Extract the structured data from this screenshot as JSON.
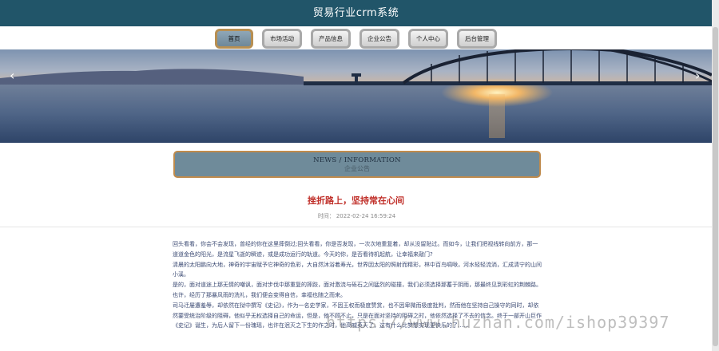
{
  "header": {
    "title": "贸易行业crm系统"
  },
  "nav": {
    "items": [
      {
        "label": "首页",
        "active": true
      },
      {
        "label": "市场活动"
      },
      {
        "label": "产品信息"
      },
      {
        "label": "企业公告"
      },
      {
        "label": "个人中心"
      },
      {
        "label": "后台管理"
      }
    ]
  },
  "banner": {
    "prev_icon": "chevron-left",
    "next_icon": "chevron-right"
  },
  "section": {
    "en": "NEWS / INFORMATION",
    "cn": "企业公告"
  },
  "article": {
    "title": "挫折路上，坚持常在心间",
    "time_label": "时间：",
    "time_value": "2022-02-24 16:59:24",
    "paragraphs": [
      "回头看看，你会不会发现，曾经的你在这里摔倒过;回头看看，你是否发现，一次次地重复着，却从没留贴过。而如今，让我们把视线转向前方，那一道道金色的阳光，是流星飞逝的瞬迹，或是成功运行的轨道。今天的你，是否看待机起航，让幸福来敲门?",
      "清晨的太阳鹏向大地，神奇的宇宙赋予它神奇的色彩，大自然沐浴着寿光，世界因太阳的照射而精彩，林中百鸟啁啾，河水轻轻流淌，汇成清宁的山间小溪。",
      "是的，面对道途上那无情的嘲讽，面对步伐中那重复的摔跤，面对激流与砾石之间猛烈的碰撞，我们必须选择那蓄于阴雨，那最终见到彩虹的荆棘路。也许，经历了那暴风雨的洗礼，我们便会变得自信，幸福也随之而来。",
      "司马迁屡遭羞辱，却依然在狱中撰写《史记》，作为一名史学家，不因王权而极度赞赏，也不因卑微而极度批判，然而他在坚持自己操守的同时，却依然要受统治阶级的阻碍，他似乎无权选择自己的命运，但是，他不顾不止，只是在面对坚持的阻碍之时，他依然选择了不去的信念。终于一部开山巨作《史记》诞生，为后人留下一份瑰瑶，也许在泯灭之下生的作之时，他高喊英天了，这有什么比梦想实现更快乐的了……"
    ]
  },
  "watermark": "https://www.huzhan.com/ishop39397"
}
